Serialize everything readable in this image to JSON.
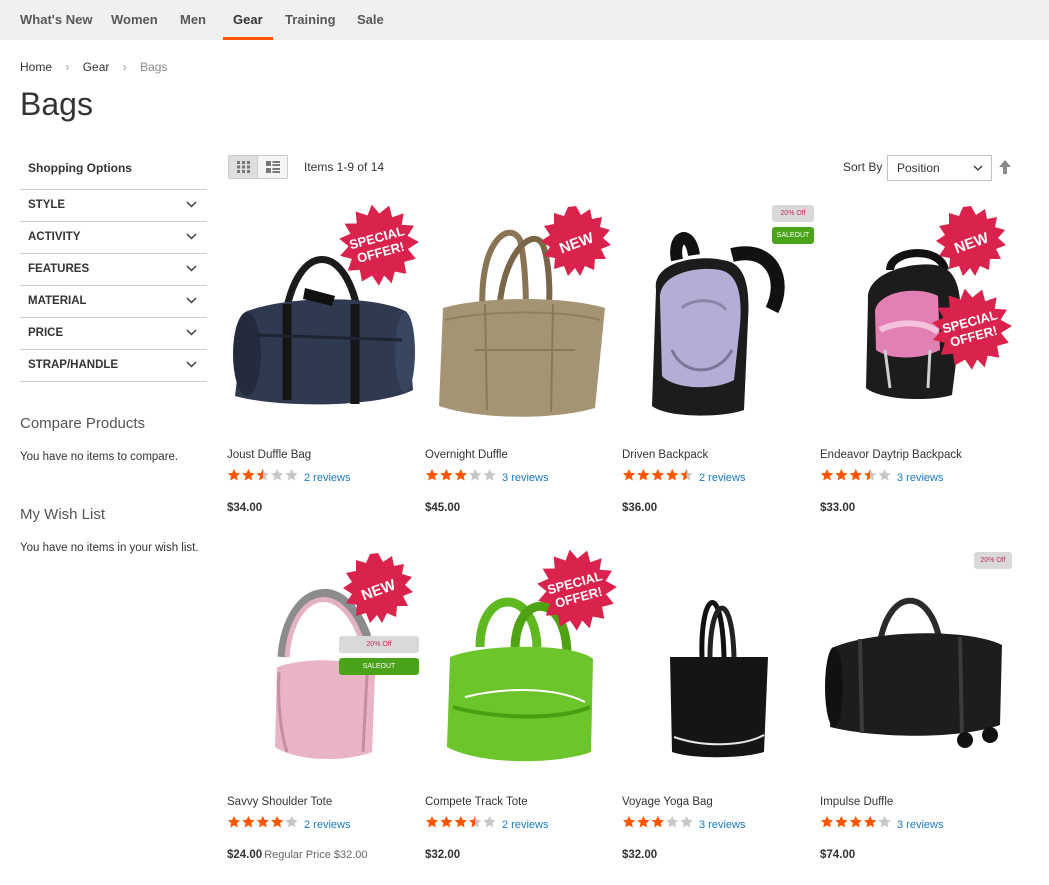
{
  "nav": {
    "items": [
      "What's New",
      "Women",
      "Men",
      "Gear",
      "Training",
      "Sale"
    ],
    "active": "Gear"
  },
  "breadcrumb": [
    "Home",
    "Gear",
    "Bags"
  ],
  "page_title": "Bags",
  "sidebar": {
    "shopping_options": "Shopping Options",
    "filters": [
      "STYLE",
      "ACTIVITY",
      "FEATURES",
      "MATERIAL",
      "PRICE",
      "STRAP/HANDLE"
    ],
    "compare_title": "Compare Products",
    "compare_text": "You have no items to compare.",
    "wishlist_title": "My Wish List",
    "wishlist_text": "You have no items in your wish list."
  },
  "toolbar": {
    "amount": "Items 1-9 of 14",
    "sort_label": "Sort By",
    "sort_value": "Position",
    "grid_icon": "grid-view-icon",
    "list_icon": "list-view-icon"
  },
  "labels": {
    "special_offer_line1": "SPECIAL",
    "special_offer_line2": "OFFER!",
    "new": "NEW",
    "off": "20% Off",
    "saleout": "SALEOUT"
  },
  "colors": {
    "accent": "#ff5501",
    "burst": "#d9234d",
    "star_on": "#ff5501",
    "star_off": "#c7c7c7",
    "link": "#1979c3",
    "saleout": "#4aa318"
  },
  "products": [
    {
      "name": "Joust Duffle Bag",
      "rating": 2.5,
      "reviews": "2 reviews",
      "price": "$34.00",
      "regular_price": ""
    },
    {
      "name": "Overnight Duffle",
      "rating": 3,
      "reviews": "3 reviews",
      "price": "$45.00",
      "regular_price": ""
    },
    {
      "name": "Driven Backpack",
      "rating": 4.5,
      "reviews": "2 reviews",
      "price": "$36.00",
      "regular_price": ""
    },
    {
      "name": "Endeavor Daytrip Backpack",
      "rating": 3.5,
      "reviews": "3 reviews",
      "price": "$33.00",
      "regular_price": ""
    },
    {
      "name": "Savvy Shoulder Tote",
      "rating": 4,
      "reviews": "2 reviews",
      "price": "$24.00",
      "regular_price": "Regular Price $32.00"
    },
    {
      "name": "Compete Track Tote",
      "rating": 3.5,
      "reviews": "2 reviews",
      "price": "$32.00",
      "regular_price": ""
    },
    {
      "name": "Voyage Yoga Bag",
      "rating": 3,
      "reviews": "3 reviews",
      "price": "$32.00",
      "regular_price": ""
    },
    {
      "name": "Impulse Duffle",
      "rating": 4,
      "reviews": "3 reviews",
      "price": "$74.00",
      "regular_price": ""
    }
  ]
}
